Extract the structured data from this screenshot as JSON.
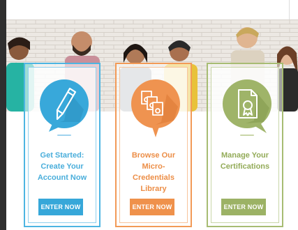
{
  "colors": {
    "blue": "#36a7d9",
    "orange": "#ef914b",
    "green": "#9cb265"
  },
  "cards": [
    {
      "icon": "pencil-icon",
      "title_lines": [
        "Get Started:",
        "Create Your",
        "Account Now"
      ],
      "button_label": "ENTER NOW"
    },
    {
      "icon": "certificates-stack-icon",
      "title_lines": [
        "Browse Our",
        "Micro-",
        "Credentials",
        "Library"
      ],
      "button_label": "ENTER NOW"
    },
    {
      "icon": "certificate-ribbon-icon",
      "title_lines": [
        "Manage Your",
        "Certifications"
      ],
      "button_label": "ENTER NOW"
    }
  ]
}
